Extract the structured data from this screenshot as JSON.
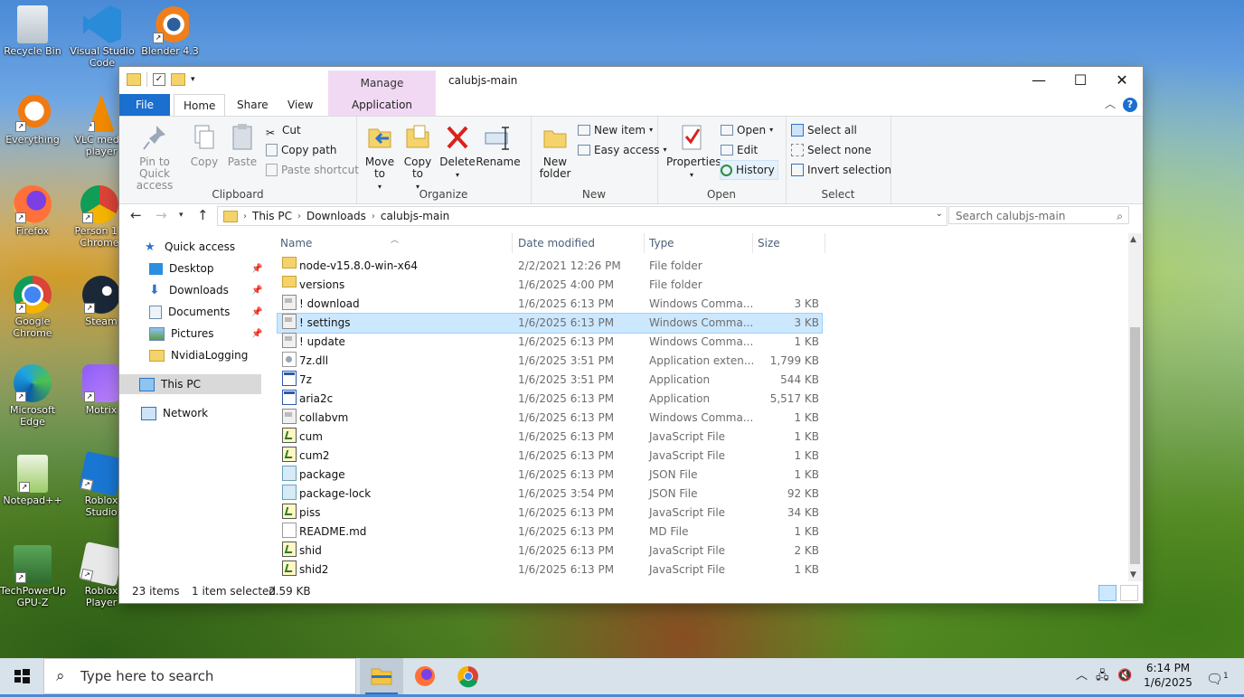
{
  "desktop": {
    "icons": [
      {
        "label": "Recycle Bin"
      },
      {
        "label": "Visual Studio Code"
      },
      {
        "label": "Blender 4.3"
      },
      {
        "label": "Everything"
      },
      {
        "label": "VLC media player"
      },
      {
        "label": "Firefox"
      },
      {
        "label": "Person 1 - Chrome"
      },
      {
        "label": "Google Chrome"
      },
      {
        "label": "Steam"
      },
      {
        "label": "Microsoft Edge"
      },
      {
        "label": "Motrix"
      },
      {
        "label": "Notepad++"
      },
      {
        "label": "Roblox Studio"
      },
      {
        "label": "TechPowerUp GPU-Z"
      },
      {
        "label": "Roblox Player"
      }
    ]
  },
  "window": {
    "title": "calubjs-main",
    "manage_tab": "Manage",
    "controls": {
      "minimize": "—",
      "maximize": "☐",
      "close": "✕"
    },
    "tabs": {
      "file": "File",
      "home": "Home",
      "share": "Share",
      "view": "View",
      "app_tools": "Application Tools"
    },
    "help": "?"
  },
  "ribbon": {
    "clipboard": {
      "label": "Clipboard",
      "pin": "Pin to Quick access",
      "copy": "Copy",
      "paste": "Paste",
      "cut": "Cut",
      "copy_path": "Copy path",
      "paste_shortcut": "Paste shortcut"
    },
    "organize": {
      "label": "Organize",
      "move_to": "Move to",
      "copy_to": "Copy to",
      "delete": "Delete",
      "rename": "Rename"
    },
    "new": {
      "label": "New",
      "new_folder": "New folder",
      "new_item": "New item",
      "easy_access": "Easy access"
    },
    "open": {
      "label": "Open",
      "properties": "Properties",
      "open": "Open",
      "edit": "Edit",
      "history": "History"
    },
    "select": {
      "label": "Select",
      "select_all": "Select all",
      "select_none": "Select none",
      "invert": "Invert selection"
    }
  },
  "address": {
    "crumbs": [
      "This PC",
      "Downloads",
      "calubjs-main"
    ],
    "search_placeholder": "Search calubjs-main"
  },
  "navpane": {
    "quick_access": "Quick access",
    "items": [
      "Desktop",
      "Downloads",
      "Documents",
      "Pictures",
      "NvidiaLogging"
    ],
    "this_pc": "This PC",
    "network": "Network"
  },
  "columns": {
    "name": "Name",
    "date": "Date modified",
    "type": "Type",
    "size": "Size"
  },
  "files": [
    {
      "name": "node-v15.8.0-win-x64",
      "date": "2/2/2021 12:26 PM",
      "type": "File folder",
      "size": "",
      "icon": "folder"
    },
    {
      "name": "versions",
      "date": "1/6/2025 4:00 PM",
      "type": "File folder",
      "size": "",
      "icon": "folder"
    },
    {
      "name": "! download",
      "date": "1/6/2025 6:13 PM",
      "type": "Windows Comma...",
      "size": "3 KB",
      "icon": "cmd"
    },
    {
      "name": "! settings",
      "date": "1/6/2025 6:13 PM",
      "type": "Windows Comma...",
      "size": "3 KB",
      "icon": "cmd",
      "selected": true
    },
    {
      "name": "! update",
      "date": "1/6/2025 6:13 PM",
      "type": "Windows Comma...",
      "size": "1 KB",
      "icon": "cmd"
    },
    {
      "name": "7z.dll",
      "date": "1/6/2025 3:51 PM",
      "type": "Application exten...",
      "size": "1,799 KB",
      "icon": "dll"
    },
    {
      "name": "7z",
      "date": "1/6/2025 3:51 PM",
      "type": "Application",
      "size": "544 KB",
      "icon": "exe"
    },
    {
      "name": "aria2c",
      "date": "1/6/2025 6:13 PM",
      "type": "Application",
      "size": "5,517 KB",
      "icon": "exe"
    },
    {
      "name": "collabvm",
      "date": "1/6/2025 6:13 PM",
      "type": "Windows Comma...",
      "size": "1 KB",
      "icon": "cmd"
    },
    {
      "name": "cum",
      "date": "1/6/2025 6:13 PM",
      "type": "JavaScript File",
      "size": "1 KB",
      "icon": "js"
    },
    {
      "name": "cum2",
      "date": "1/6/2025 6:13 PM",
      "type": "JavaScript File",
      "size": "1 KB",
      "icon": "js"
    },
    {
      "name": "package",
      "date": "1/6/2025 6:13 PM",
      "type": "JSON File",
      "size": "1 KB",
      "icon": "json"
    },
    {
      "name": "package-lock",
      "date": "1/6/2025 3:54 PM",
      "type": "JSON File",
      "size": "92 KB",
      "icon": "json"
    },
    {
      "name": "piss",
      "date": "1/6/2025 6:13 PM",
      "type": "JavaScript File",
      "size": "34 KB",
      "icon": "js"
    },
    {
      "name": "README.md",
      "date": "1/6/2025 6:13 PM",
      "type": "MD File",
      "size": "1 KB",
      "icon": "md"
    },
    {
      "name": "shid",
      "date": "1/6/2025 6:13 PM",
      "type": "JavaScript File",
      "size": "2 KB",
      "icon": "js"
    },
    {
      "name": "shid2",
      "date": "1/6/2025 6:13 PM",
      "type": "JavaScript File",
      "size": "1 KB",
      "icon": "js"
    }
  ],
  "status": {
    "count": "23 items",
    "selected": "1 item selected",
    "size": "2.59 KB"
  },
  "taskbar": {
    "search_placeholder": "Type here to search",
    "time": "6:14 PM",
    "date": "1/6/2025",
    "notifications": "1"
  },
  "colors": {
    "accent": "#1a6fcf",
    "manage": "#f1d9f4",
    "selection": "#cce8ff"
  }
}
